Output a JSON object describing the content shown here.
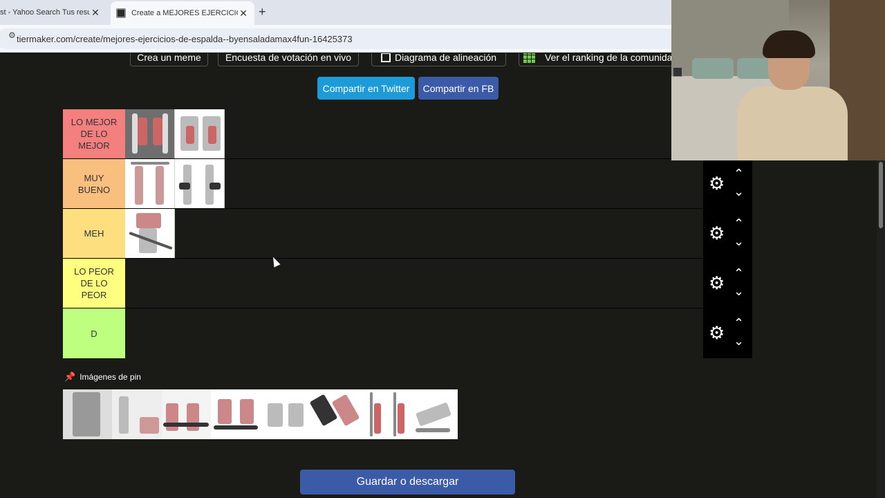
{
  "browser": {
    "tabs": [
      {
        "title": "st - Yahoo Search Tus resu",
        "active": false
      },
      {
        "title": "Create a MEJORES EJERCICIOS",
        "active": true
      }
    ],
    "close_glyph": "✕",
    "new_tab_glyph": "+",
    "url": "tiermaker.com/create/mejores-ejercicios-de-espalda--byensaladamax4fun-16425373"
  },
  "top_buttons": [
    {
      "label": "Crea un meme",
      "icon": "meme-icon"
    },
    {
      "label": "Encuesta de votación en vivo",
      "icon": "poll-icon"
    },
    {
      "label": "Diagrama de alineación",
      "icon": "alignment-icon"
    },
    {
      "label": "Ver el ranking de la comunidad",
      "icon": "community-ranking-icon"
    }
  ],
  "share": {
    "twitter_label": "Compartir en Twitter",
    "facebook_label": "Compartir en FB"
  },
  "tiers": [
    {
      "label": "LO MEJOR DE LO MEJOR",
      "color": "#f47f7f",
      "item_count": 2
    },
    {
      "label": "MUY BUENO",
      "color": "#f8bf7f",
      "item_count": 2
    },
    {
      "label": "MEH",
      "color": "#fedf7f",
      "item_count": 1
    },
    {
      "label": "LO PEOR DE LO PEOR",
      "color": "#feff7f",
      "item_count": 0
    },
    {
      "label": "D",
      "color": "#bfff7f",
      "item_count": 0
    }
  ],
  "tier_controls": {
    "settings_glyph": "⚙",
    "up_glyph": "⌃",
    "down_glyph": "⌄"
  },
  "pool": {
    "title": "Imágenes de pin",
    "pin_glyph": "📌",
    "item_count": 8
  },
  "save_label": "Guardar o descargar",
  "colors": {
    "background": "#1a1a17",
    "twitter": "#1d9bd9",
    "facebook": "#3b5aa8"
  }
}
